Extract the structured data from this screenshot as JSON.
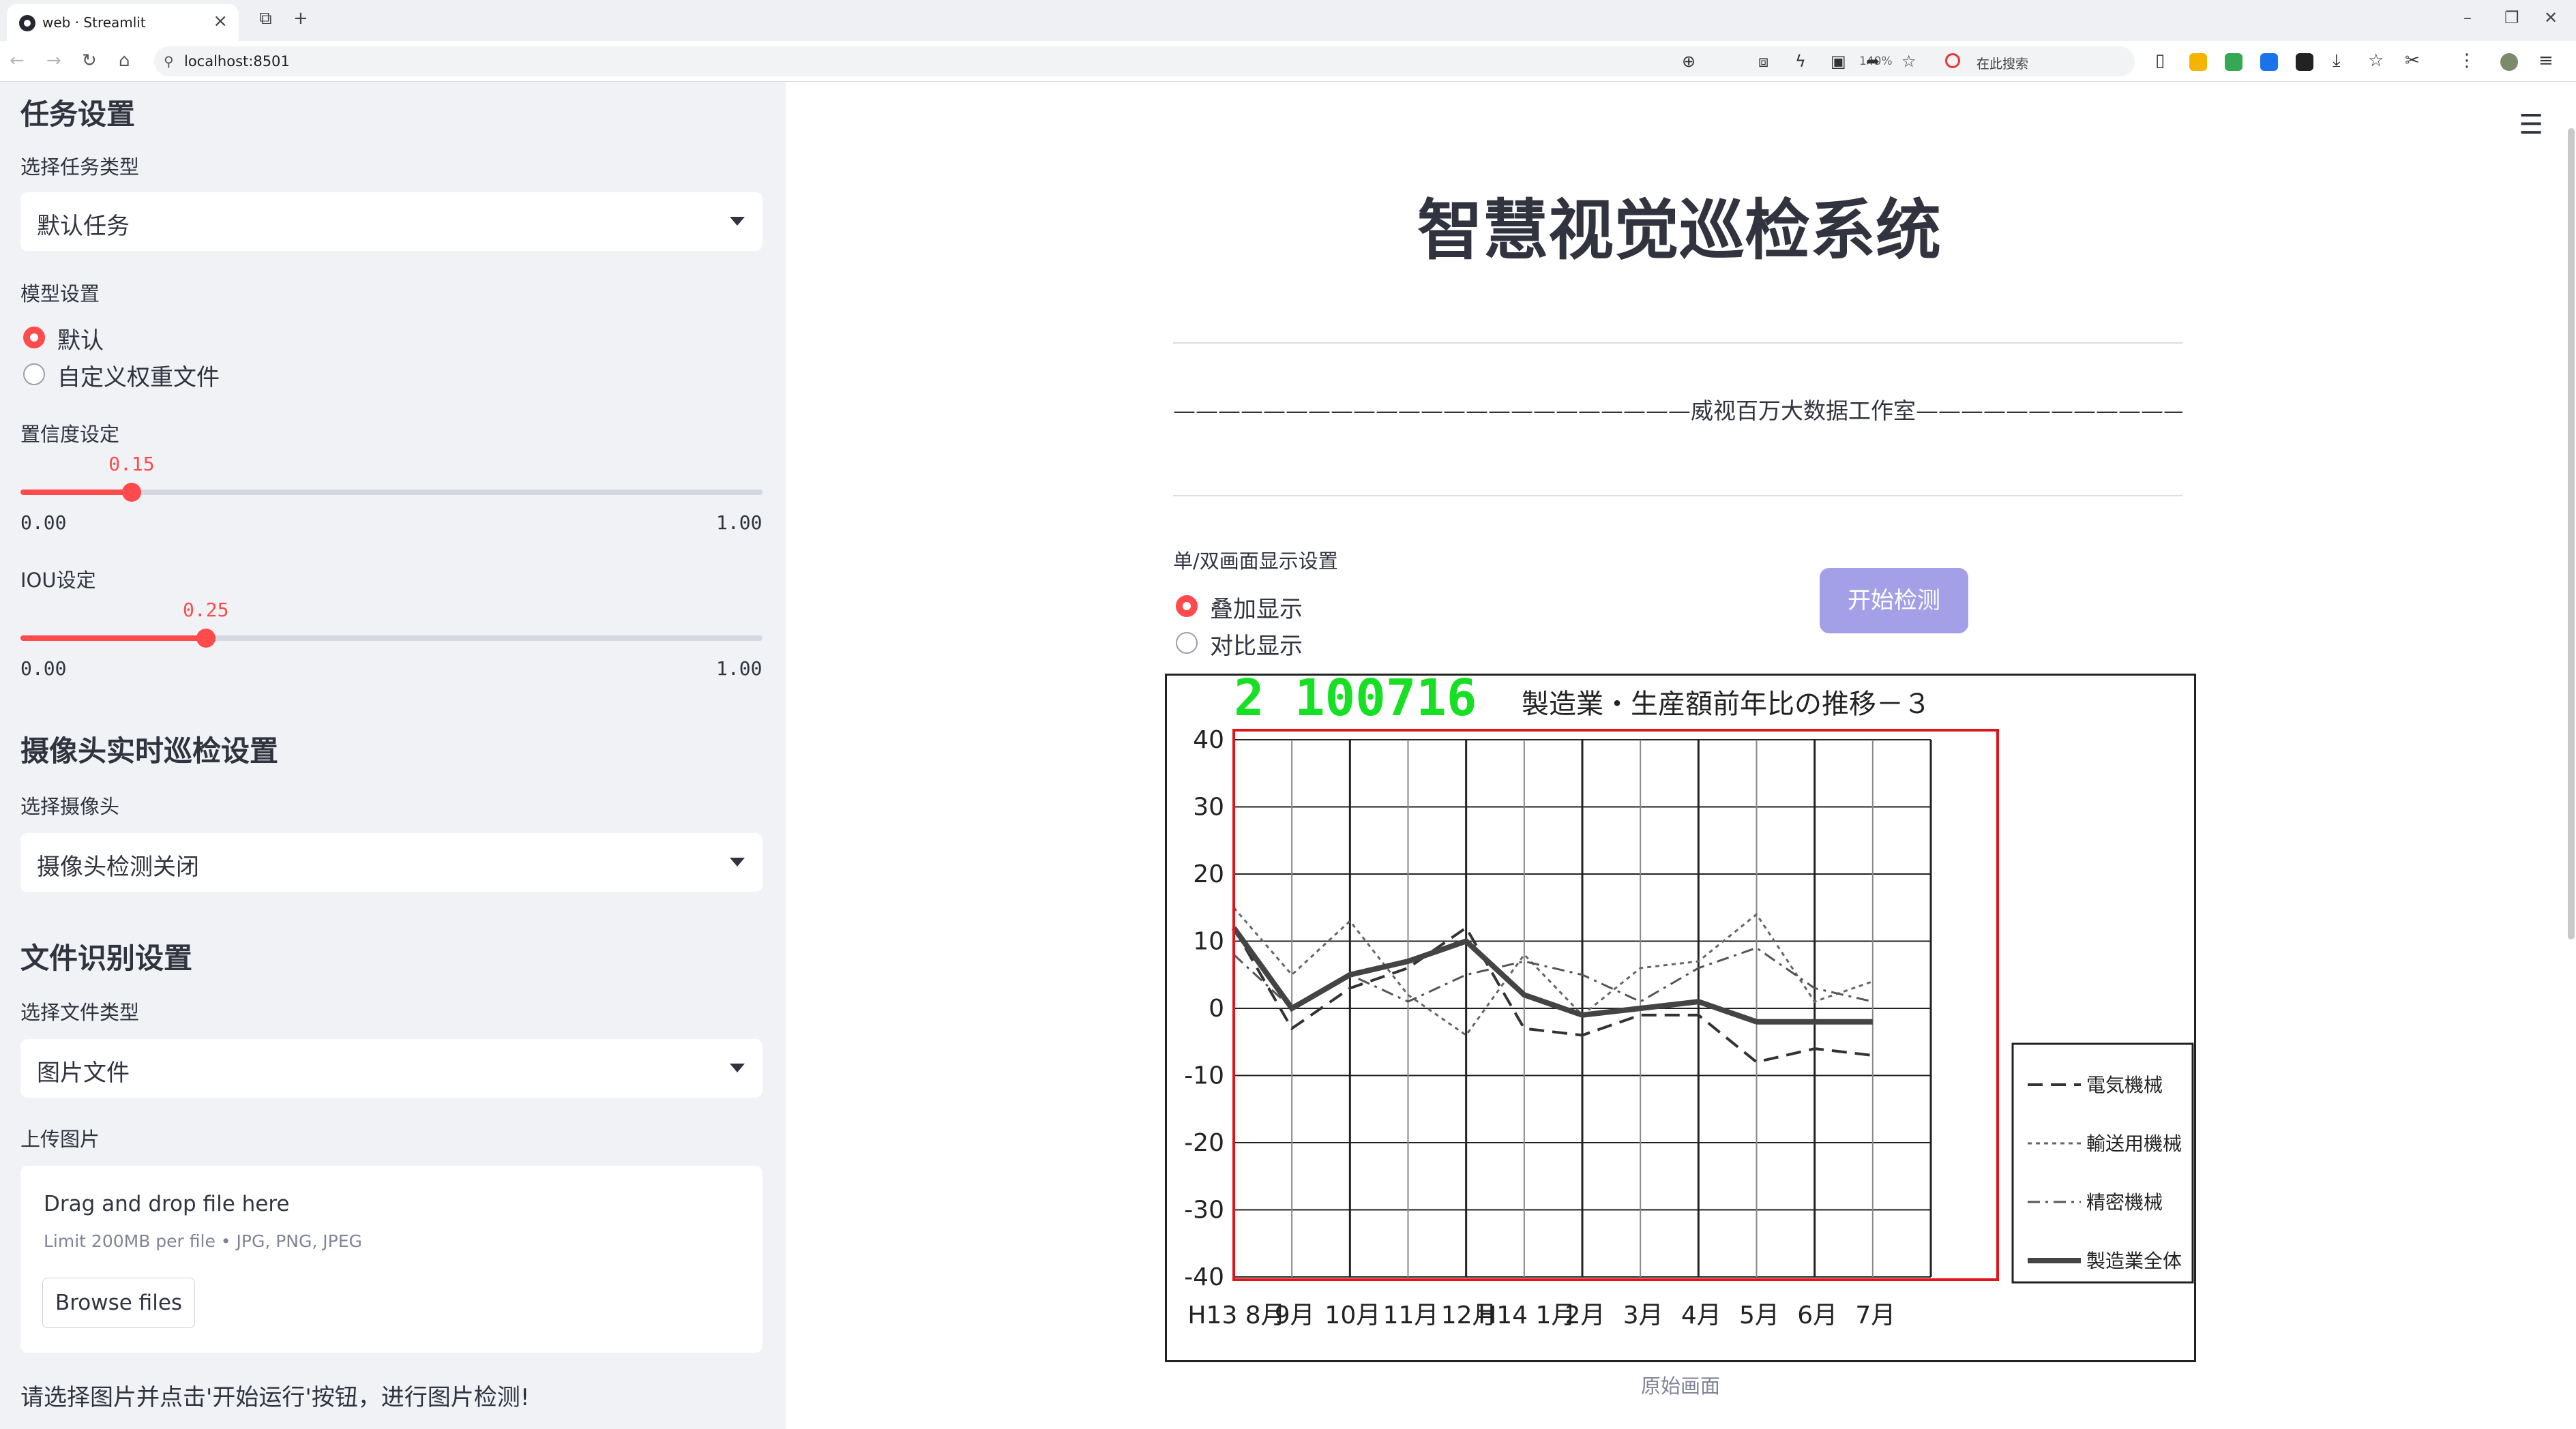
{
  "browser": {
    "tab_title": "web · Streamlit",
    "url": "localhost:8501",
    "zoom": "140%",
    "search_placeholder": "在此搜索"
  },
  "sidebar": {
    "task_section": {
      "heading": "任务设置",
      "select_label": "选择任务类型",
      "select_value": "默认任务"
    },
    "model": {
      "label": "模型设置",
      "options": [
        "默认",
        "自定义权重文件"
      ],
      "selected": "默认"
    },
    "confidence": {
      "label": "置信度设定",
      "value": 0.15,
      "value_text": "0.15",
      "min_text": "0.00",
      "max_text": "1.00"
    },
    "iou": {
      "label": "IOU设定",
      "value": 0.25,
      "value_text": "0.25",
      "min_text": "0.00",
      "max_text": "1.00"
    },
    "camera_section": {
      "heading": "摄像头实时巡检设置",
      "select_label": "选择摄像头",
      "select_value": "摄像头检测关闭"
    },
    "file_section": {
      "heading": "文件识别设置",
      "select_label": "选择文件类型",
      "select_value": "图片文件",
      "upload_label": "上传图片",
      "drop_text": "Drag and drop file here",
      "limit_text": "Limit 200MB per file • JPG, PNG, JPEG",
      "browse_label": "Browse files"
    },
    "note": "请选择图片并点击'开始运行'按钮，进行图片检测!"
  },
  "main": {
    "title": "智慧视觉巡检系统",
    "studio": "———————————————————————威视百万大数据工作室————————————————————————",
    "display_label": "单/双画面显示设置",
    "display_options": [
      "叠加显示",
      "对比显示"
    ],
    "display_selected": "叠加显示",
    "start_button": "开始检测",
    "caption": "原始画面",
    "detection_label": "2  100716",
    "image_chart": {
      "title": "製造業・生産額前年比の推移－３",
      "y_ticks": [
        "40",
        "30",
        "20",
        "10",
        "0",
        "-10",
        "-20",
        "-30",
        "-40"
      ],
      "x_ticks": [
        "H13 8月",
        "9月",
        "10月",
        "11月",
        "12月",
        "H14 1月",
        "2月",
        "3月",
        "4月",
        "5月",
        "6月",
        "7月"
      ],
      "legend": [
        "電気機械",
        "輸送用機械",
        "精密機械",
        "製造業全体"
      ],
      "series": [
        {
          "name": "電気機械",
          "values": [
            12,
            -3,
            3,
            6,
            12,
            -3,
            -4,
            -1,
            -1,
            -8,
            -6,
            -7
          ]
        },
        {
          "name": "輸送用機械",
          "values": [
            15,
            5,
            13,
            2,
            -4,
            8,
            -1,
            6,
            7,
            14,
            1,
            4
          ]
        },
        {
          "name": "精密機械",
          "values": [
            8,
            0,
            5,
            1,
            5,
            7,
            5,
            1,
            6,
            9,
            3,
            1
          ]
        },
        {
          "name": "製造業全体",
          "values": [
            12,
            0,
            5,
            7,
            10,
            2,
            -1,
            0,
            1,
            -2,
            -2,
            -2
          ]
        }
      ]
    }
  }
}
